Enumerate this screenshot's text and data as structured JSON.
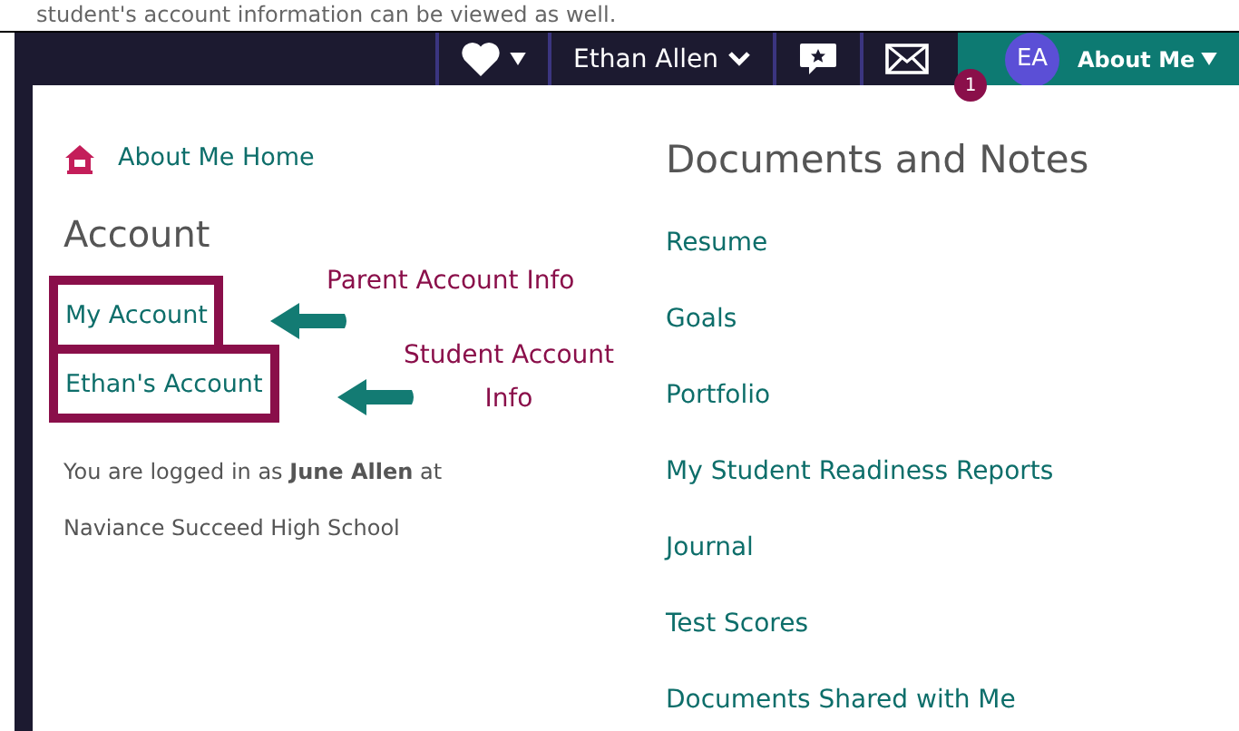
{
  "caption": "student's account information can be viewed as well.",
  "navbar": {
    "user_menu": "Ethan Allen",
    "avatar": "EA",
    "about_me": "About Me",
    "badge": "1"
  },
  "menu": {
    "home_link": "About Me Home",
    "account": {
      "heading": "Account",
      "links": [
        "My Account",
        "Ethan's Account"
      ],
      "login_note": "You are logged in as **June Allen** at Naviance Succeed High School"
    },
    "documents": {
      "heading": "Documents and Notes",
      "links": [
        "Resume",
        "Goals",
        "Portfolio",
        "My Student Readiness Reports",
        "Journal",
        "Test Scores",
        "Documents Shared with Me"
      ]
    }
  },
  "annotations": [
    {
      "text": "Parent Account Info"
    },
    {
      "text": "Student Account Info"
    }
  ]
}
